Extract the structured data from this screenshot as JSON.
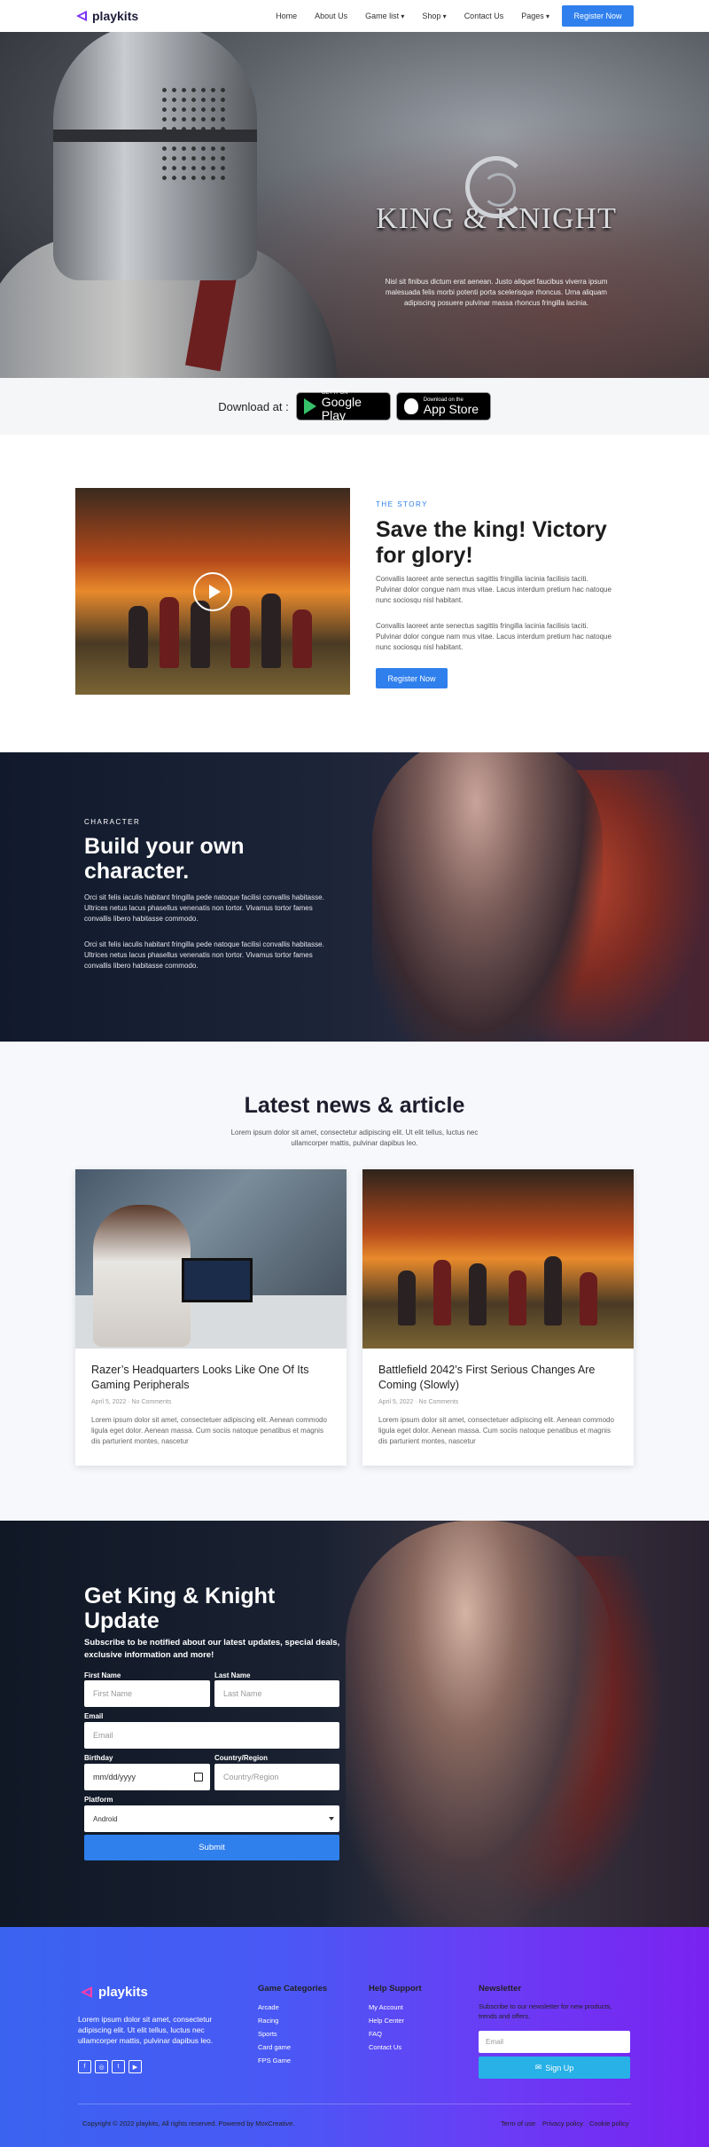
{
  "nav": {
    "logo_text": "playkits",
    "links": [
      "Home",
      "About Us",
      "Game list",
      "Shop",
      "Contact Us",
      "Pages"
    ],
    "register_label": "Register Now",
    "brand_color": "#7b2ff7",
    "accent_color": "#2f80ed"
  },
  "hero": {
    "game_title": "KING & KNIGHT",
    "text": "Nisl sit finibus dictum erat aenean. Justo aliquet faucibus viverra ipsum malesuada felis morbi potenti porta scelerisque rhoncus. Urna aliquam adipiscing posuere pulvinar massa rhoncus fringilla lacinia."
  },
  "download": {
    "label": "Download at :",
    "google_small": "GET IT ON",
    "google_big": "Google Play",
    "apple_small": "Download on the",
    "apple_big": "App Store"
  },
  "story": {
    "eyebrow": "THE STORY",
    "title": "Save the king! Victory for glory!",
    "paragraphs": [
      "Convallis laoreet ante senectus sagittis fringilla lacinia facilisis taciti. Pulvinar dolor congue nam mus vitae. Lacus interdum pretium hac natoque nunc sociosqu nisl habitant.",
      "Convallis laoreet ante senectus sagittis fringilla lacinia facilisis taciti. Pulvinar dolor congue nam mus vitae. Lacus interdum pretium hac natoque nunc sociosqu nisl habitant."
    ],
    "button_label": "Register Now"
  },
  "character": {
    "eyebrow": "CHARACTER",
    "title": "Build your own character.",
    "paragraphs": [
      "Orci sit felis iaculis habitant fringilla pede natoque facilisi convallis habitasse. Ultrices netus lacus phasellus venenatis non tortor. Vivamus tortor fames convallis libero habitasse commodo.",
      "Orci sit felis iaculis habitant fringilla pede natoque facilisi convallis habitasse. Ultrices netus lacus phasellus venenatis non tortor. Vivamus tortor fames convallis libero habitasse commodo."
    ]
  },
  "news": {
    "title": "Latest news & article",
    "subtitle": "Lorem ipsum dolor sit amet, consectetur adipiscing elit. Ut elit tellus, luctus nec ullamcorper mattis, pulvinar dapibus leo.",
    "articles": [
      {
        "title": "Razer’s Headquarters Looks Like One Of Its Gaming Peripherals",
        "date": "April 5, 2022",
        "comments": "No Comments",
        "excerpt": "Lorem ipsum dolor sit amet, consectetuer adipiscing elit. Aenean commodo ligula eget dolor. Aenean massa. Cum sociis natoque penatibus et magnis dis parturient montes, nascetur"
      },
      {
        "title": "Battlefield 2042’s First Serious Changes Are Coming (Slowly)",
        "date": "April 5, 2022",
        "comments": "No Comments",
        "excerpt": "Lorem ipsum dolor sit amet, consectetuer adipiscing elit. Aenean commodo ligula eget dolor. Aenean massa. Cum sociis natoque penatibus et magnis dis parturient montes, nascetur"
      }
    ]
  },
  "signup": {
    "title": "Get King & Knight Update",
    "subtitle": "Subscribe to be notified about our latest updates, special deals, exclusive information and more!",
    "first_name_label": "First Name",
    "first_name_placeholder": "First Name",
    "last_name_label": "Last Name",
    "last_name_placeholder": "Last Name",
    "email_label": "Email",
    "email_placeholder": "Email",
    "birthday_label": "Birthday",
    "birthday_placeholder": "mm/dd/yyyy",
    "country_label": "Country/Region",
    "country_placeholder": "Country/Region",
    "platform_label": "Platform",
    "platform_value": "Android",
    "submit_label": "Submit"
  },
  "footer": {
    "logo_text": "playkits",
    "description": "Lorem ipsum dolor sit amet, consectetur adipiscing elit. Ut elit tellus, luctus nec ullamcorper mattis, pulvinar dapibus leo.",
    "socials": [
      "f",
      "◎",
      "t",
      "▶"
    ],
    "game_categories_title": "Game Categories",
    "game_categories": [
      "Arcade",
      "Racing",
      "Sports",
      "Card game",
      "FPS Game"
    ],
    "help_title": "Help Support",
    "help_links": [
      "My Account",
      "Help Center",
      "FAQ",
      "Contact Us"
    ],
    "newsletter_title": "Newsletter",
    "newsletter_text": "Subscribe to our newsletter for new products, trends and offers.",
    "email_placeholder": "Email",
    "signup_label": "Sign Up",
    "copyright": "Copyright © 2022 playkits, All rights reserved. Powered by MoxCreative.",
    "legal_links": [
      "Term of use",
      "Privacy policy",
      "Cookie policy"
    ]
  }
}
